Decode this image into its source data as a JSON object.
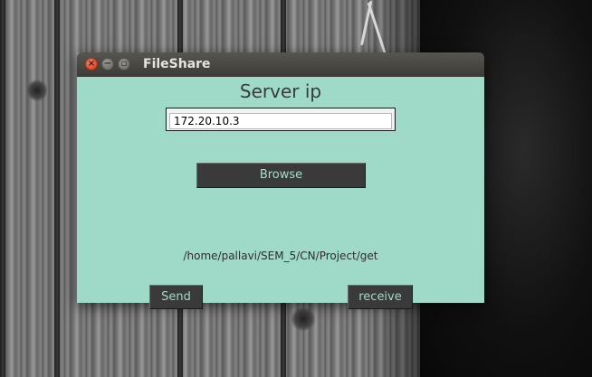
{
  "window": {
    "title": "FileShare",
    "controls": {
      "close": "×",
      "minimize": "−",
      "maximize": "▫"
    }
  },
  "form": {
    "heading": "Server ip",
    "server_ip_value": "172.20.10.3",
    "browse_label": "Browse",
    "selected_path": "/home/pallavi/SEM_5/CN/Project/get",
    "send_label": "Send",
    "receive_label": "receive"
  },
  "colors": {
    "client_background": "#9fd9c8",
    "button_background": "#3a3a3a",
    "button_text": "#9fd9c8",
    "titlebar": "#3d3b37",
    "close_button": "#e0482a"
  }
}
